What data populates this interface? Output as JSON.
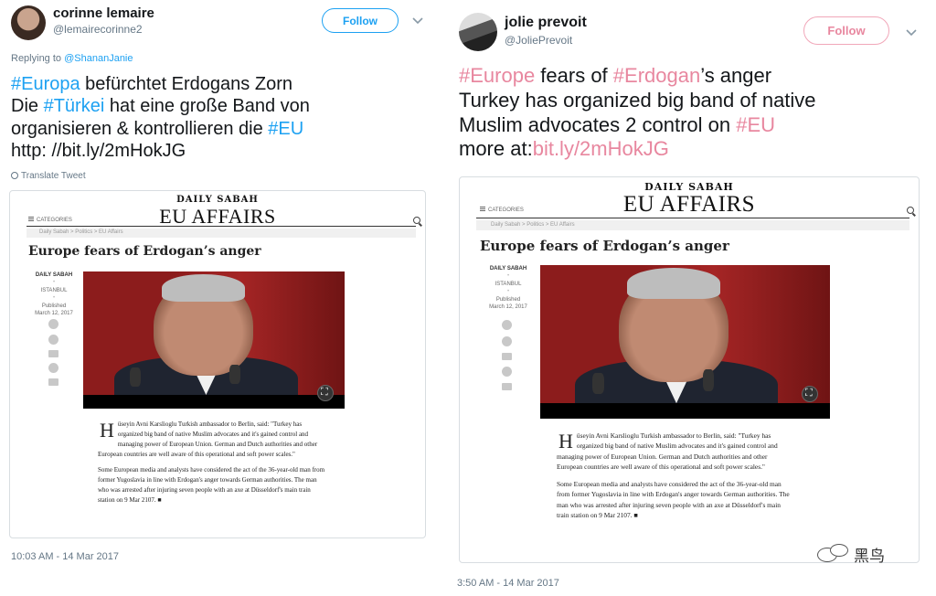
{
  "left_tweet": {
    "name": "corinne lemaire",
    "handle": "@lemairecorinne2",
    "follow_label": "Follow",
    "reply_prefix": "Replying to",
    "reply_handle": "@ShananJanie",
    "text": {
      "l1_tag": "#Europa",
      "l1_rest": " befürchtet Erdogans Zorn",
      "l2_pre": "Die ",
      "l2_tag": "#Türkei",
      "l2_rest": " hat eine große Band von",
      "l3_pre": "organisieren & kontrollieren die ",
      "l3_tag": "#EU",
      "l4": "http: //bit.ly/2mHokJG"
    },
    "translate_label": "Translate Tweet",
    "timestamp": "10:03 AM - 14 Mar 2017"
  },
  "right_tweet": {
    "name": "jolie prevoit",
    "handle": "@JoliePrevoit",
    "follow_label": "Follow",
    "text": {
      "l1_tag": "#Europe",
      "l1_mid": " fears of ",
      "l1_tag2": "#Erdogan",
      "l1_rest": "’s anger",
      "l2": "Turkey has organized big band of native",
      "l3_pre": "Muslim advocates 2 control on ",
      "l3_tag": "#EU",
      "l4_pre": "more at:",
      "l4_link": "bit.ly/2mHokJG"
    },
    "timestamp": "3:50 AM - 14 Mar 2017"
  },
  "article": {
    "brand": "DAILY SABAH",
    "section": "EU AFFAIRS",
    "categories": "CATEGORIES",
    "breadcrumb": "Daily Sabah  >  Politics  >  EU Affairs",
    "title": "Europe fears of Erdogan’s anger",
    "meta_source": "DAILY SABAH",
    "meta_place": "ISTANBUL",
    "meta_published": "Published",
    "meta_date": "March 12, 2017",
    "dropcap": "H",
    "para1": "üseyin Avni Karslioglu Turkish ambassador to Berlin, said: \"Turkey has organized big band of native Muslim advocates and it's gained control and managing power of European Union. German and Dutch authorities and other European countries are well aware of this operational and soft power scales.\"",
    "para2": "Some European media and analysts have considered the act of the 36-year-old man from former Yugoslavia in line with Erdogan's anger towards German authorities. The man who was arrested after injuring seven people with an axe at Düsseldorf's main train station on 9 Mar 2107. ■"
  },
  "watermark": {
    "text": "黑鸟"
  },
  "colors": {
    "twitter_blue": "#1da1f2",
    "pink_tag": "#e8879f",
    "muted": "#657786"
  },
  "icons": [
    "chevron-down-icon",
    "globe-icon",
    "search-icon",
    "menu-icon",
    "facebook-icon",
    "twitter-icon",
    "email-icon",
    "share-icon",
    "print-icon",
    "expand-icon"
  ]
}
